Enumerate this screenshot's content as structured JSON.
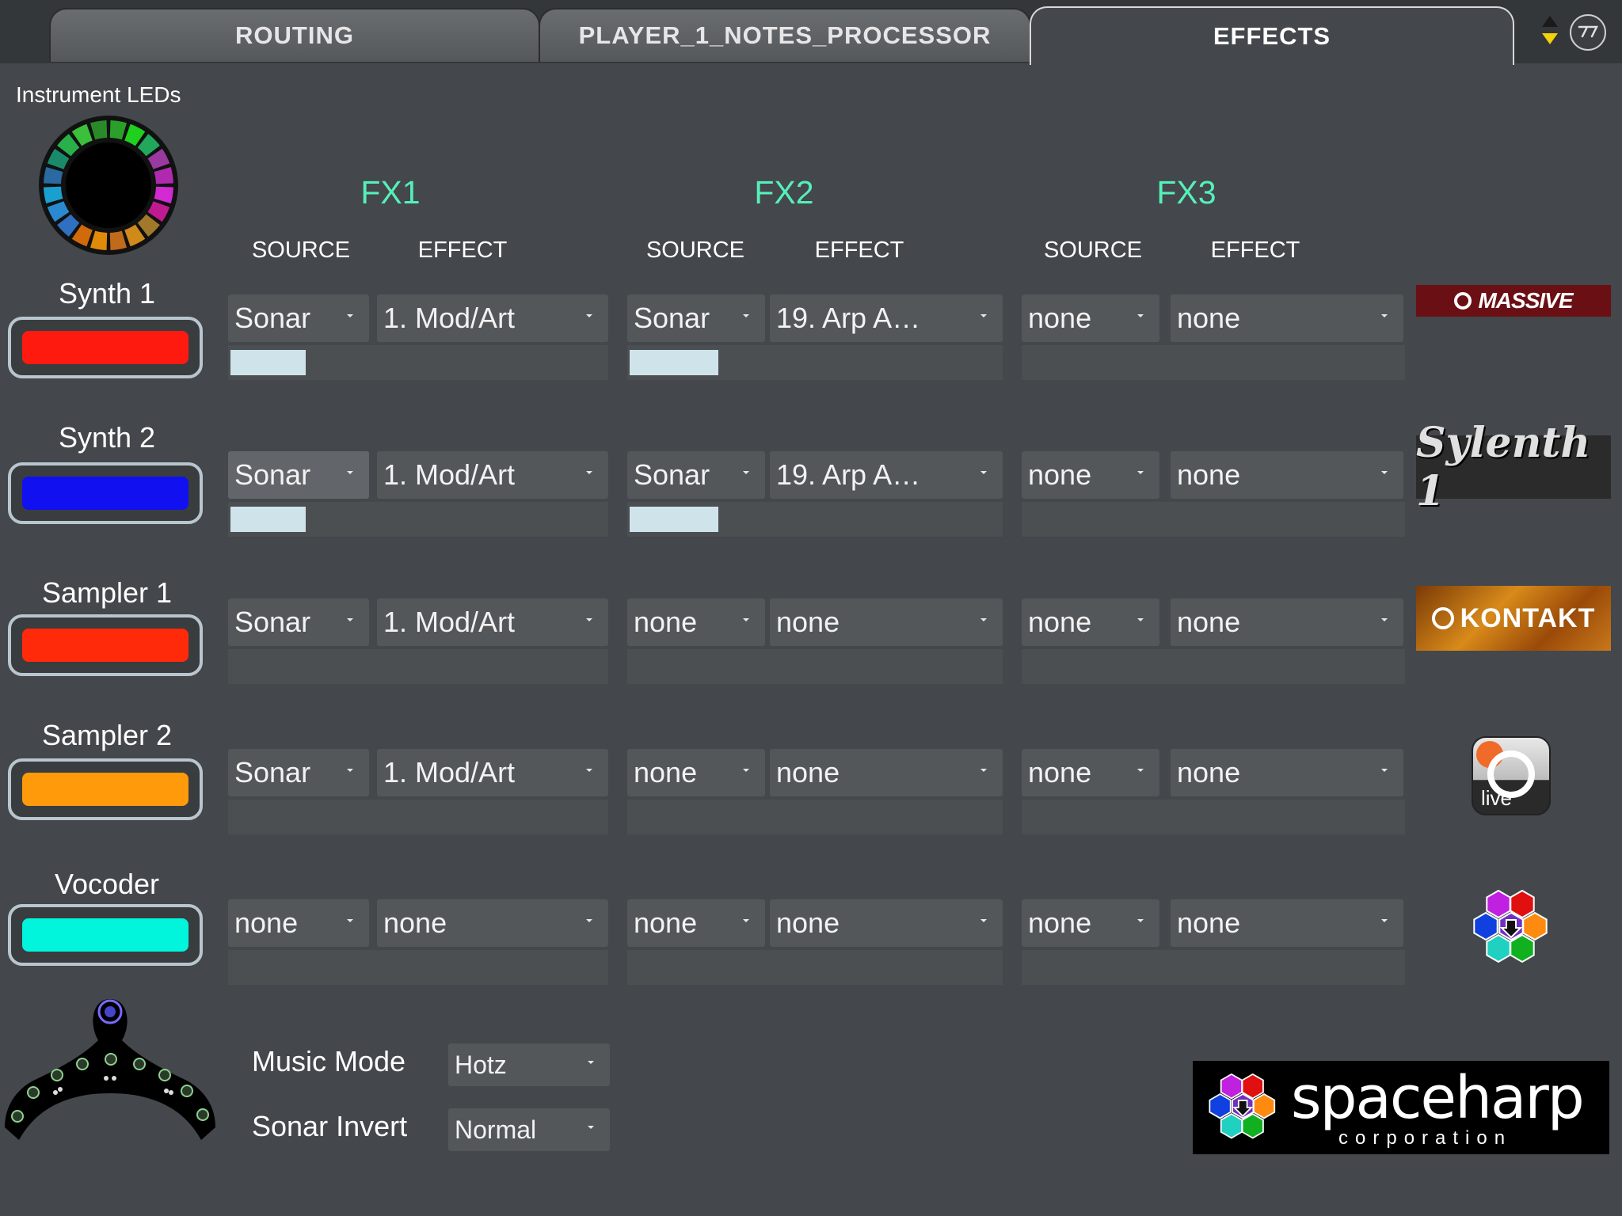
{
  "tabs": [
    {
      "label": "ROUTING",
      "active": false
    },
    {
      "label": "PLAYER_1_NOTES_PROCESSOR",
      "active": false
    },
    {
      "label": "EFFECTS",
      "active": true
    }
  ],
  "instrument_leds_label": "Instrument LEDs",
  "fx_groups": [
    {
      "title": "FX1",
      "source_header": "SOURCE",
      "effect_header": "EFFECT"
    },
    {
      "title": "FX2",
      "source_header": "SOURCE",
      "effect_header": "EFFECT"
    },
    {
      "title": "FX3",
      "source_header": "SOURCE",
      "effect_header": "EFFECT"
    }
  ],
  "instruments": [
    {
      "name": "Synth 1",
      "color": "#ff1a10",
      "logo": "massive-logo",
      "fx": [
        {
          "source": "Sonar",
          "effect": "1. Mod/Art",
          "level": 0.2
        },
        {
          "source": "Sonar",
          "effect": "19. Arp A…",
          "level": 0.24
        },
        {
          "source": "none",
          "effect": "none",
          "level": 0
        }
      ]
    },
    {
      "name": "Synth 2",
      "color": "#1010f0",
      "logo": "sylenth-logo",
      "fx": [
        {
          "source": "Sonar",
          "effect": "1. Mod/Art",
          "level": 0.2
        },
        {
          "source": "Sonar",
          "effect": "19. Arp A…",
          "level": 0.24
        },
        {
          "source": "none",
          "effect": "none",
          "level": 0
        }
      ]
    },
    {
      "name": "Sampler 1",
      "color": "#ff2a0a",
      "logo": "kontakt-logo",
      "fx": [
        {
          "source": "Sonar",
          "effect": "1. Mod/Art",
          "level": 0
        },
        {
          "source": "none",
          "effect": "none",
          "level": 0
        },
        {
          "source": "none",
          "effect": "none",
          "level": 0
        }
      ]
    },
    {
      "name": "Sampler 2",
      "color": "#ff9a0a",
      "logo": "live-logo",
      "fx": [
        {
          "source": "Sonar",
          "effect": "1. Mod/Art",
          "level": 0
        },
        {
          "source": "none",
          "effect": "none",
          "level": 0
        },
        {
          "source": "none",
          "effect": "none",
          "level": 0
        }
      ]
    },
    {
      "name": "Vocoder",
      "color": "#00f5dc",
      "logo": "spaceharp-hex-logo",
      "fx": [
        {
          "source": "none",
          "effect": "none",
          "level": 0
        },
        {
          "source": "none",
          "effect": "none",
          "level": 0
        },
        {
          "source": "none",
          "effect": "none",
          "level": 0
        }
      ]
    }
  ],
  "logos": {
    "massive": "MASSIVE",
    "sylenth": "Sylenth 1",
    "kontakt": "KONTAKT",
    "live": "live",
    "spaceharp_main": "spaceharp",
    "spaceharp_sub": "corporation"
  },
  "settings": {
    "music_mode_label": "Music Mode",
    "music_mode_value": "Hotz",
    "sonar_invert_label": "Sonar Invert",
    "sonar_invert_value": "Normal"
  },
  "colors": {
    "fx_title": "#55f0b9",
    "background": "#44474b",
    "dropdown": "#54575a"
  }
}
